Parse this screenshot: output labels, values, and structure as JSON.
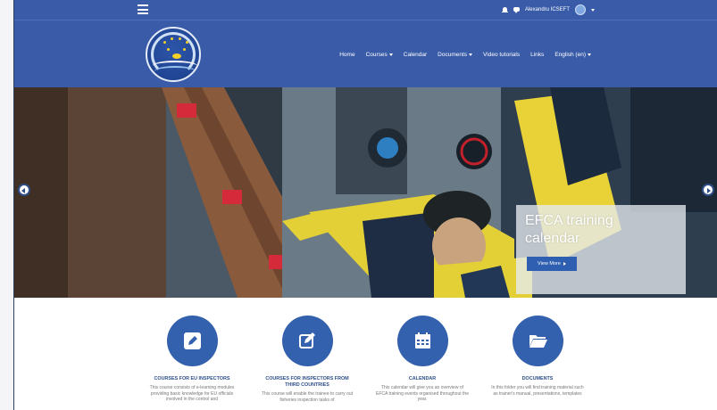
{
  "topbar": {
    "menu_icon": "hamburger-icon",
    "notification_icon": "bell-icon",
    "chat_icon": "chat-icon",
    "user_name": "Alexandru ICSEFT",
    "avatar_icon": "avatar-icon"
  },
  "nav": {
    "items": [
      {
        "label": "Home",
        "dropdown": false
      },
      {
        "label": "Courses",
        "dropdown": true
      },
      {
        "label": "Calendar",
        "dropdown": false
      },
      {
        "label": "Documents",
        "dropdown": true
      },
      {
        "label": "Video tutorials",
        "dropdown": false
      },
      {
        "label": "Links",
        "dropdown": false
      },
      {
        "label": "English (en)",
        "dropdown": true
      }
    ]
  },
  "hero": {
    "caption_title": "EFCA training calendar",
    "button_label": "View More"
  },
  "features": [
    {
      "title": "COURSES FOR EU INSPECTORS",
      "desc": "This course consists of e-learning modules providing basic knowledge for EU officials involved in the control and",
      "icon": "pencil-icon"
    },
    {
      "title": "COURSES FOR INSPECTORS FROM THIRD COUNTRIES",
      "desc": "This course will enable the trainee to carry out fisheries inspection tasks of",
      "icon": "edit-icon"
    },
    {
      "title": "CALENDAR",
      "desc": "This calendar will give you an overview of EFCA training events organised throughout the year.",
      "icon": "calendar-icon"
    },
    {
      "title": "DOCUMENTS",
      "desc": "In this folder you will find training material such as trainer's manual, presentations, templates",
      "icon": "folder-icon"
    }
  ],
  "colors": {
    "header": "#3a5ca8",
    "accent": "#3461ad",
    "title_text": "#2e4f8a"
  }
}
